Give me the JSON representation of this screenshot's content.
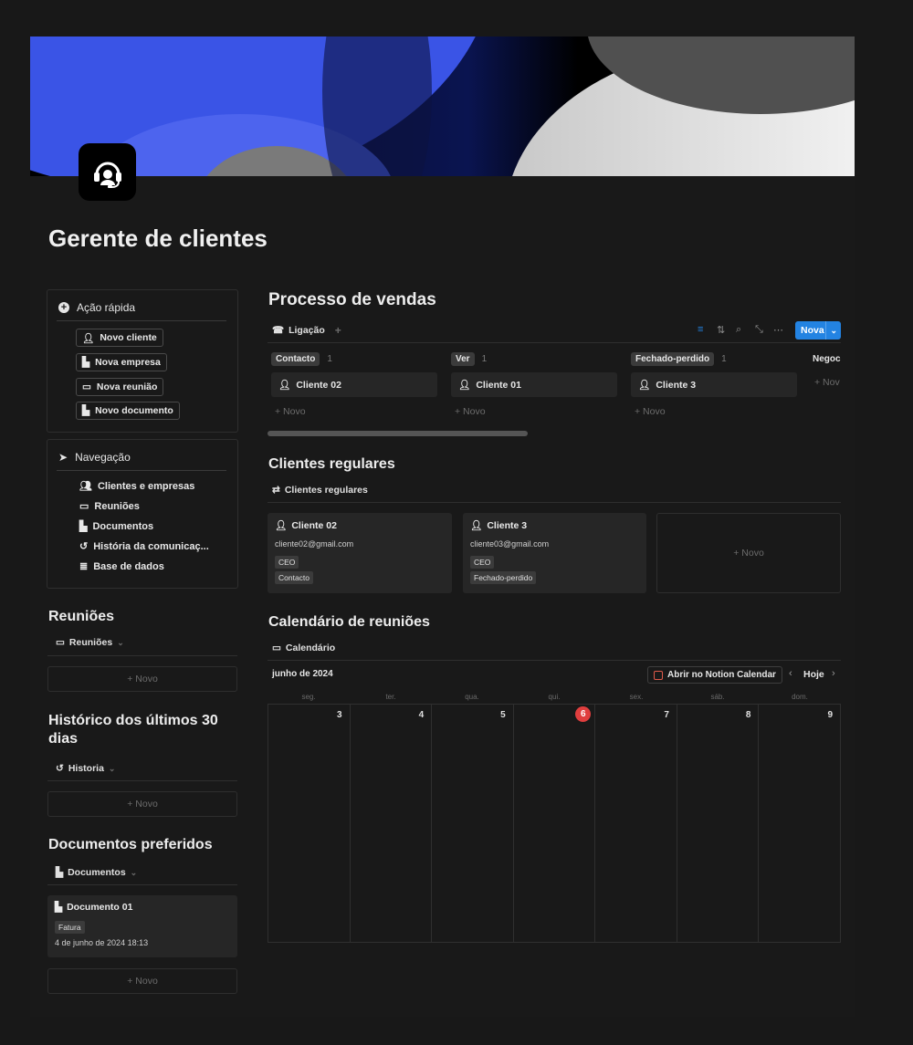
{
  "page": {
    "title": "Gerente de clientes"
  },
  "quick_action": {
    "title": "Ação rápida",
    "buttons": [
      "Novo cliente",
      "Nova empresa",
      "Nova reunião",
      "Novo documento"
    ]
  },
  "navigation": {
    "title": "Navegação",
    "items": [
      "Clientes e empresas",
      "Reuniões",
      "Documentos",
      "História da comunicaç...",
      "Base de dados"
    ]
  },
  "meetings": {
    "title": "Reuniões",
    "view": "Reuniões",
    "new": "+ Novo"
  },
  "history": {
    "title": "Histórico dos últimos 30 dias",
    "view": "Historia",
    "new": "+ Novo"
  },
  "docs": {
    "title": "Documentos preferidos",
    "view": "Documentos",
    "card": {
      "name": "Documento 01",
      "tag": "Fatura",
      "date": "4 de junho de 2024 18:13"
    },
    "new": "+ Novo"
  },
  "sales": {
    "title": "Processo de vendas",
    "view": "Ligação",
    "new_button": "Nova",
    "columns": [
      {
        "name": "Contacto",
        "count": "1",
        "card": "Cliente 02",
        "new": "+ Novo"
      },
      {
        "name": "Ver",
        "count": "1",
        "card": "Cliente 01",
        "new": "+ Novo"
      },
      {
        "name": "Fechado-perdido",
        "count": "1",
        "card": "Cliente 3",
        "new": "+ Novo"
      },
      {
        "name": "Negoc",
        "count": "",
        "card": "",
        "new": "+ Nov"
      }
    ]
  },
  "regulars": {
    "title": "Clientes regulares",
    "view": "Clientes regulares",
    "cards": [
      {
        "name": "Cliente 02",
        "email": "cliente02@gmail.com",
        "role": "CEO",
        "status": "Contacto"
      },
      {
        "name": "Cliente 3",
        "email": "cliente03@gmail.com",
        "role": "CEO",
        "status": "Fechado-perdido"
      }
    ],
    "new": "+ Novo"
  },
  "calendar": {
    "title": "Calendário de reuniões",
    "view": "Calendário",
    "month": "junho de 2024",
    "open_btn": "Abrir no Notion Calendar",
    "today_btn": "Hoje",
    "weekdays": [
      "seg.",
      "ter.",
      "qua.",
      "qui.",
      "sex.",
      "sáb.",
      "dom."
    ],
    "days": [
      "3",
      "4",
      "5",
      "6",
      "7",
      "8",
      "9"
    ],
    "today_index": 3
  },
  "colors": {
    "accent": "#2383e2",
    "today": "#e03e3e",
    "background": "#191919"
  }
}
